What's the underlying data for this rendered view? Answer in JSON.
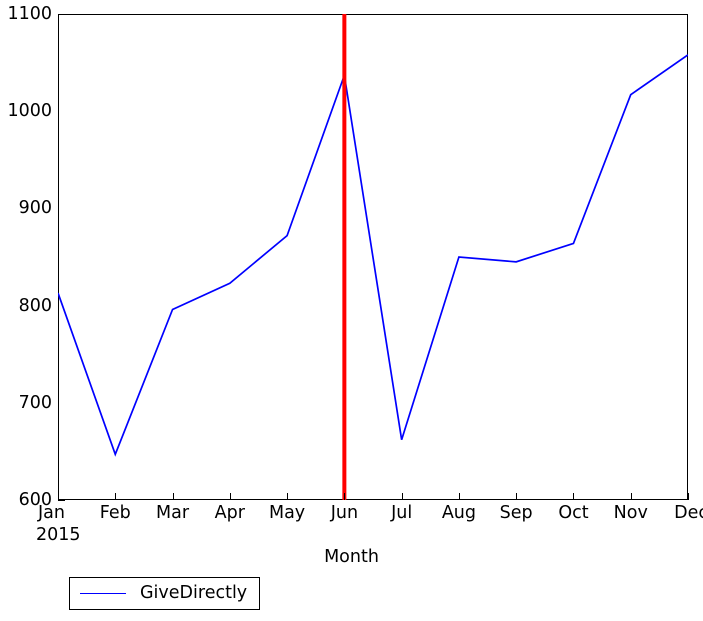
{
  "chart_data": {
    "type": "line",
    "title": "",
    "xlabel": "Month",
    "ylabel": "",
    "categories": [
      "Jan",
      "Feb",
      "Mar",
      "Apr",
      "May",
      "Jun",
      "Jul",
      "Aug",
      "Sep",
      "Oct",
      "Nov",
      "Dec"
    ],
    "x_sublabel": "2015",
    "ylim": [
      600,
      1100
    ],
    "yticks": [
      600,
      700,
      800,
      900,
      1000,
      1100
    ],
    "ytick_labels": [
      "600",
      "700",
      "800",
      "900",
      "1000",
      "1100"
    ],
    "grid": false,
    "legend_position": "below-left",
    "series": [
      {
        "name": "GiveDirectly",
        "color": "#0000ff",
        "values": [
          813,
          647,
          796,
          823,
          872,
          1037,
          662,
          850,
          845,
          864,
          1017,
          1058
        ]
      }
    ],
    "annotations": [
      {
        "type": "vertical-line",
        "name": "june-marker",
        "x": "Jun",
        "color": "#ff0000",
        "linewidth": 4,
        "y_from": 600,
        "y_to": 1100
      }
    ]
  },
  "legend": {
    "entries": [
      {
        "label": "GiveDirectly",
        "color": "#0000ff"
      }
    ]
  },
  "axis": {
    "xlabel": "Month",
    "x_sublabel": "2015"
  }
}
